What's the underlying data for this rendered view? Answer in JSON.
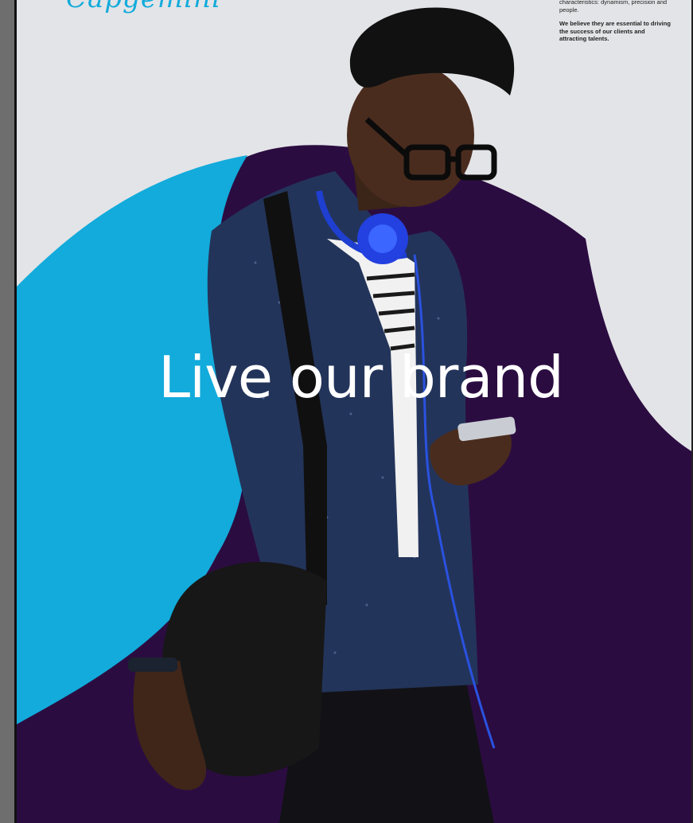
{
  "brand": {
    "logo_text": "Capgemini",
    "colors": {
      "light_bg": "#e3e4e7",
      "purple": "#2b0c41",
      "cyan": "#12abdb"
    }
  },
  "side_copy": {
    "paragraph_1": "characteristics: dynamism, precision and people.",
    "paragraph_2": "We believe they are essential to driving the success of our clients and attracting talents."
  },
  "headline": "Live our brand",
  "photo": {
    "subject": "man-with-headphones-and-phone-icon"
  }
}
